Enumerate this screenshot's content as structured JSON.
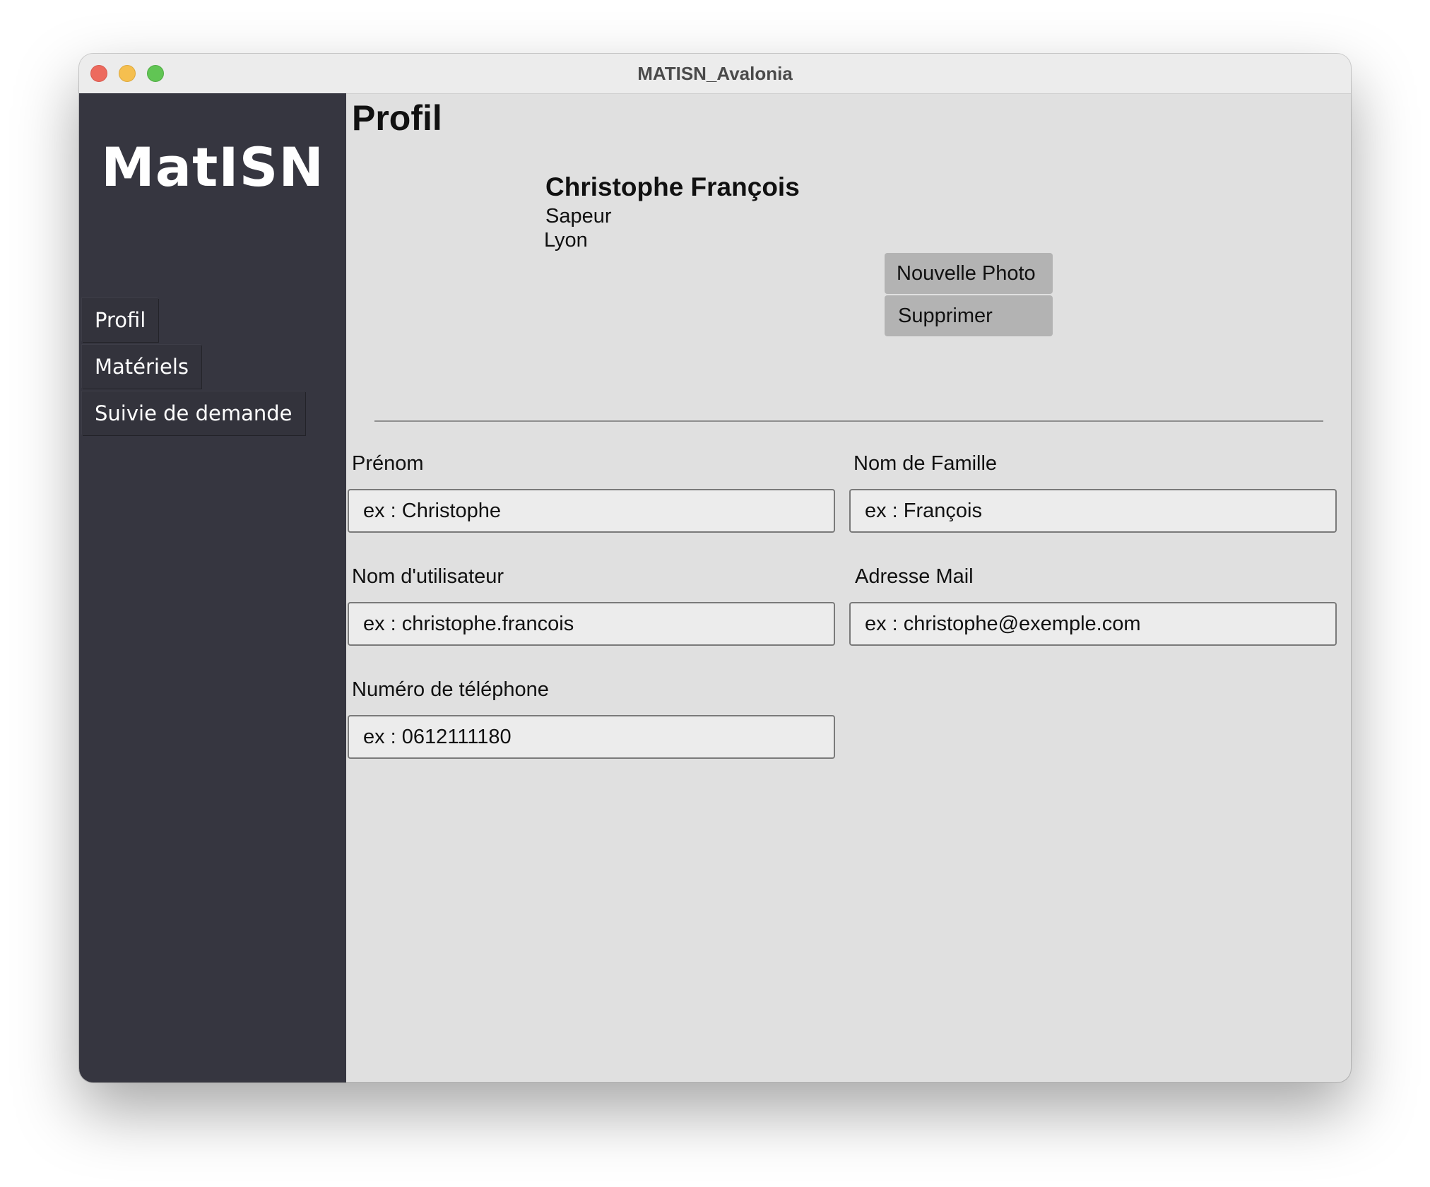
{
  "window": {
    "title": "MATISN_Avalonia"
  },
  "sidebar": {
    "logo": "MatISN",
    "items": [
      {
        "label": "Profil"
      },
      {
        "label": "Matériels"
      },
      {
        "label": "Suivie de demande"
      }
    ]
  },
  "page": {
    "title": "Profil"
  },
  "profile": {
    "name": "Christophe François",
    "role": "Sapeur",
    "city": "Lyon",
    "new_photo_label": "Nouvelle Photo",
    "delete_label": "Supprimer"
  },
  "form": {
    "first_name": {
      "label": "Prénom",
      "placeholder": "ex : Christophe"
    },
    "last_name": {
      "label": "Nom de Famille",
      "placeholder": "ex : François"
    },
    "username": {
      "label": "Nom d'utilisateur",
      "placeholder": "ex : christophe.francois"
    },
    "email": {
      "label": "Adresse Mail",
      "placeholder": "ex : christophe@exemple.com"
    },
    "phone": {
      "label": "Numéro de téléphone",
      "placeholder": "ex : 0612111180"
    }
  }
}
